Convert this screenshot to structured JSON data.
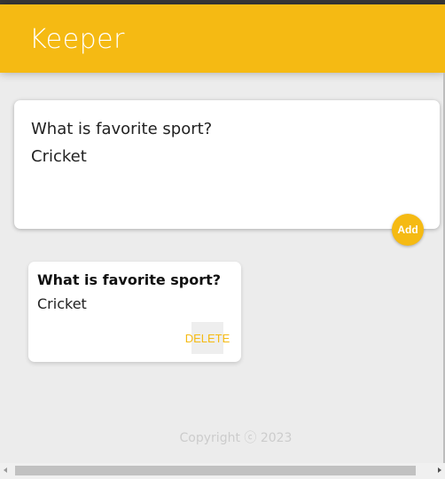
{
  "app": {
    "title": "Keeper"
  },
  "form": {
    "title_value": "What is favorite sport?",
    "content_value": "Cricket",
    "add_label": "Add"
  },
  "notes": [
    {
      "title": "What is favorite sport?",
      "content": "Cricket",
      "delete_label": "DELETE"
    }
  ],
  "footer": {
    "text": "Copyright ⓒ 2023"
  },
  "colors": {
    "accent": "#f5ba13",
    "background": "#ececec",
    "card": "#ffffff"
  }
}
